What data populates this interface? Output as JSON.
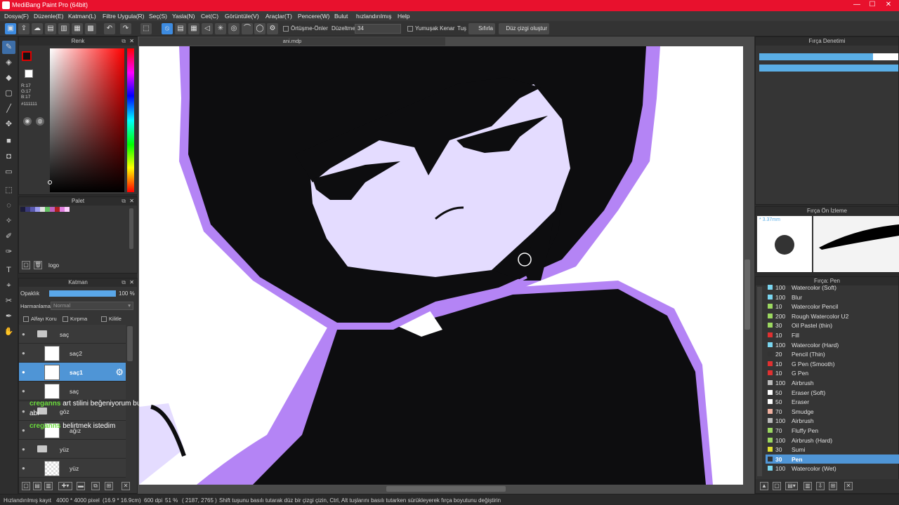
{
  "window": {
    "title": "MediBang Paint Pro (64bit)",
    "minimize": "—",
    "maximize": "☐",
    "close": "✕"
  },
  "menu": [
    "Dosya(F)",
    "Düzenle(E)",
    "Katman(L)",
    "Filtre Uygula(R)",
    "Seç(S)",
    "Yasla(N)",
    "Cet(C)",
    "Görüntüle(V)",
    "Araçlar(T)",
    "Pencere(W)",
    "Bulut",
    "hızlandırılmış",
    "Help"
  ],
  "toolbar": {
    "overlap_label": "Örtüşme-Önler",
    "correction_label": "Düzeltme",
    "correction_value": "34",
    "soft_edge_label": "Yumuşak Kenar",
    "tug_label": "Tuş",
    "reset_label": "Sıfırla",
    "straight_line_label": "Düz çizgi oluştur"
  },
  "document_tab": "ani.mdp",
  "color_panel": {
    "title": "Renk",
    "r": "R:17",
    "g": "G:17",
    "b": "B:17",
    "hex": "#111111",
    "primary_color": "#111111",
    "secondary_color": "#ffffff"
  },
  "palette_panel": {
    "title": "Palet",
    "swatches": [
      "#1c1c3a",
      "#3a3a7a",
      "#5a5ab0",
      "#9b9bf0",
      "#e0e0e0",
      "#60c060",
      "#c060c0",
      "#b02020",
      "#e080e0",
      "#ffd0ff"
    ],
    "tab_name": "logo"
  },
  "layer_panel": {
    "title": "Katman",
    "opacity_label": "Opaklık",
    "opacity_value": "100 %",
    "opacity_fraction": 1.0,
    "blend_label": "Harmanlama",
    "blend_value": "Normal",
    "alpha_protect": "Alfayı Koru",
    "clipping": "Kırpma",
    "lock": "Kilitle",
    "layers": [
      {
        "name": "saç",
        "type": "folder"
      },
      {
        "name": "saç2",
        "type": "layer"
      },
      {
        "name": "saç1",
        "type": "layer",
        "selected": true
      },
      {
        "name": "saç",
        "type": "layer"
      },
      {
        "name": "göz",
        "type": "folder"
      },
      {
        "name": "ağız",
        "type": "layer"
      },
      {
        "name": "yüz",
        "type": "folder"
      },
      {
        "name": "yüz",
        "type": "layer"
      }
    ]
  },
  "chat": [
    {
      "user": "creganns",
      "message": "art stilini beğeniyorum bu",
      "extra": "abi"
    },
    {
      "user": "creganns",
      "message": "belirtmek istedim"
    }
  ],
  "brush_control": {
    "title": "Fırça Denetimi"
  },
  "brush_preview": {
    "title": "Fırça Ön İzleme",
    "size_label": "* 3.37mm"
  },
  "brush_list": {
    "title": "Fırça: Pen",
    "items": [
      {
        "size": "100",
        "name": "Watercolor (Soft)",
        "color": "#7ad6f0"
      },
      {
        "size": "100",
        "name": "Blur",
        "color": "#7ad6f0"
      },
      {
        "size": "10",
        "name": "Watercolor Pencil",
        "color": "#9cd860"
      },
      {
        "size": "200",
        "name": "Rough Watercolor U2",
        "color": "#9cd860"
      },
      {
        "size": "30",
        "name": "Oil Pastel (thin)",
        "color": "#9cd860"
      },
      {
        "size": "10",
        "name": "Fill",
        "color": "#e03030"
      },
      {
        "size": "100",
        "name": "Watercolor (Hard)",
        "color": "#7ad6f0"
      },
      {
        "size": "20",
        "name": "Pencil (Thin)",
        "color": "#333333"
      },
      {
        "size": "10",
        "name": "G Pen (Smooth)",
        "color": "#e03030"
      },
      {
        "size": "10",
        "name": "G Pen",
        "color": "#e03030"
      },
      {
        "size": "100",
        "name": "Airbrush",
        "color": "#bbbbbb"
      },
      {
        "size": "50",
        "name": "Eraser (Soft)",
        "color": "#ffffff"
      },
      {
        "size": "50",
        "name": "Eraser",
        "color": "#ffffff"
      },
      {
        "size": "70",
        "name": "Smudge",
        "color": "#f0b0a0"
      },
      {
        "size": "100",
        "name": "Airbrush",
        "color": "#bbbbbb"
      },
      {
        "size": "70",
        "name": "Fluffy Pen",
        "color": "#9cd860"
      },
      {
        "size": "100",
        "name": "Airbrush (Hard)",
        "color": "#9cd860"
      },
      {
        "size": "30",
        "name": "Sumi",
        "color": "#e0e030"
      },
      {
        "size": "30",
        "name": "Pen",
        "color": "#333333",
        "selected": true
      },
      {
        "size": "100",
        "name": "Watercolor (Wet)",
        "color": "#7ad6f0"
      }
    ]
  },
  "status": {
    "mode": "Hızlandırılmış kayıt",
    "canvas_size": "4000 * 4000 pixel",
    "physical_size": "(16.9 * 16.9cm)",
    "dpi": "600 dpi",
    "zoom": "51 %",
    "coords": "( 2187, 2765 )",
    "hint": "Shift tuşunu basılı tutarak düz bir çizgi çizin, Ctrl, Alt tuşlarını basılı tutarken sürükleyerek fırça boyutunu değiştirin"
  },
  "colors": {
    "accent": "#4f95d6",
    "titlebar": "#e8112d",
    "art_lavender": "#e4dcff",
    "art_purple": "#b484f5",
    "art_black": "#0d0d0f"
  }
}
